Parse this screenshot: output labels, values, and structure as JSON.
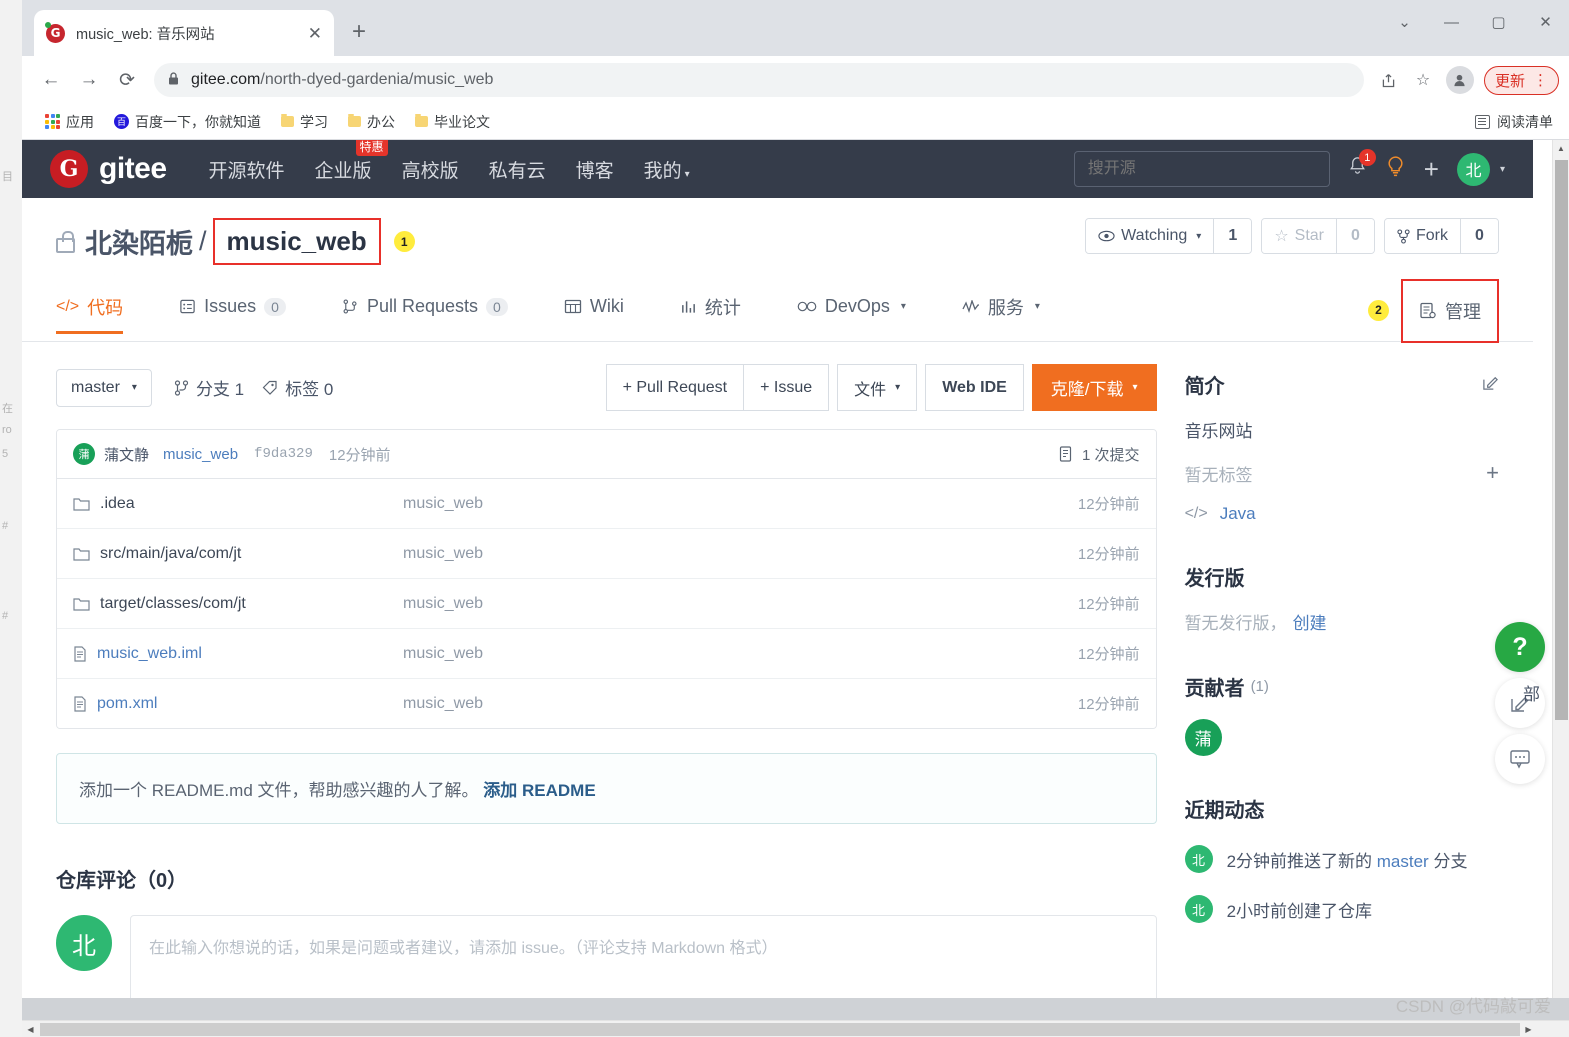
{
  "browser": {
    "tab": {
      "title": "music_web: 音乐网站",
      "favicon": "gitee-favicon",
      "close": "✕"
    },
    "new_tab": "+",
    "window_controls": {
      "minimize_more": "⌄",
      "minimize": "—",
      "maximize": "▢",
      "close": "✕"
    },
    "nav": {
      "back": "←",
      "forward": "→",
      "reload": "⟳"
    },
    "url": {
      "lock": "🔒",
      "domain": "gitee.com",
      "path": "/north-dyed-gardenia/music_web",
      "full": "gitee.com/north-dyed-gardenia/music_web"
    },
    "omnibox_actions": {
      "share": "share-icon",
      "bookmark": "☆",
      "profile": "profile-icon"
    },
    "update_button": {
      "label": "更新",
      "menu": "⋮"
    },
    "bookmarks": [
      {
        "label": "应用",
        "icon": "apps-grid-icon"
      },
      {
        "label": "百度一下，你就知道",
        "icon": "baidu-icon"
      },
      {
        "label": "学习",
        "icon": "folder-icon"
      },
      {
        "label": "办公",
        "icon": "folder-icon"
      },
      {
        "label": "毕业论文",
        "icon": "folder-icon"
      }
    ],
    "reading_list": {
      "label": "阅读清单",
      "icon": "reading-list-icon"
    }
  },
  "gitee_nav": {
    "logo_mark": "G",
    "logo_text": "gitee",
    "links": [
      {
        "label": "开源软件",
        "badge": ""
      },
      {
        "label": "企业版",
        "badge": "特惠"
      },
      {
        "label": "高校版",
        "badge": ""
      },
      {
        "label": "私有云",
        "badge": ""
      },
      {
        "label": "博客",
        "badge": ""
      },
      {
        "label": "我的",
        "badge": "",
        "caret": "▾"
      }
    ],
    "search_placeholder": "搜开源",
    "notifications_count": "1",
    "bulb_icon": "lightbulb-icon",
    "plus_icon": "+",
    "avatar": "北",
    "avatar_caret": "▾"
  },
  "repo": {
    "owner": "北染陌栀",
    "separator": "/",
    "name": "music_web",
    "annotation_1": "1",
    "watching": {
      "label": "Watching",
      "count": "1",
      "caret": "▾",
      "icon": "eye-icon"
    },
    "star": {
      "label": "Star",
      "count": "0",
      "icon": "star-icon"
    },
    "fork": {
      "label": "Fork",
      "count": "0",
      "icon": "fork-icon"
    }
  },
  "tabs": [
    {
      "label": "代码",
      "icon": "code-icon",
      "count": "",
      "active": true
    },
    {
      "label": "Issues",
      "icon": "issues-icon",
      "count": "0",
      "active": false
    },
    {
      "label": "Pull Requests",
      "icon": "pull-request-icon",
      "count": "0",
      "active": false
    },
    {
      "label": "Wiki",
      "icon": "wiki-icon",
      "count": "",
      "active": false
    },
    {
      "label": "统计",
      "icon": "chart-icon",
      "count": "",
      "active": false
    },
    {
      "label": "DevOps",
      "icon": "devops-icon",
      "count": "",
      "caret": "▾",
      "active": false
    },
    {
      "label": "服务",
      "icon": "service-icon",
      "count": "",
      "caret": "▾",
      "active": false
    }
  ],
  "tabs_annotation_2": "2",
  "manage_tab": {
    "label": "管理",
    "icon": "manage-icon"
  },
  "toolbar": {
    "branch": "master",
    "branch_caret": "▾",
    "branches_label": "分支 1",
    "tags_label": "标签 0",
    "pull_request_btn": "+ Pull Request",
    "issue_btn": "+ Issue",
    "files_btn": "文件",
    "files_caret": "▾",
    "web_ide_btn": "Web IDE",
    "clone_btn": "克隆/下载",
    "clone_caret": "▾"
  },
  "commit": {
    "avatar": "蒲",
    "author": "蒲文静",
    "message": "music_web",
    "sha": "f9da329",
    "time": "12分钟前",
    "count_label": "1 次提交",
    "count_icon": "commits-icon"
  },
  "files": [
    {
      "name": ".idea",
      "type": "dir",
      "message": "music_web",
      "time": "12分钟前"
    },
    {
      "name": "src/main/java/com/jt",
      "type": "dir",
      "message": "music_web",
      "time": "12分钟前"
    },
    {
      "name": "target/classes/com/jt",
      "type": "dir",
      "message": "music_web",
      "time": "12分钟前"
    },
    {
      "name": "music_web.iml",
      "type": "file",
      "message": "music_web",
      "time": "12分钟前"
    },
    {
      "name": "pom.xml",
      "type": "file",
      "message": "music_web",
      "time": "12分钟前"
    }
  ],
  "readme_notice": {
    "text": "添加一个 README.md 文件，帮助感兴趣的人了解。",
    "link": "添加 README"
  },
  "comments": {
    "title": "仓库评论（0）",
    "avatar": "北",
    "placeholder": "在此输入你想说的话，如果是问题或者建议，请添加 issue。（评论支持 Markdown 格式）"
  },
  "sidebar": {
    "intro_title": "简介",
    "intro_edit_icon": "edit-icon",
    "description": "音乐网站",
    "no_tags": "暂无标签",
    "add_tag_icon": "+",
    "language": "Java",
    "language_icon": "code-icon",
    "releases_title": "发行版",
    "no_releases": "暂无发行版，",
    "create_release": "创建",
    "contributors_title": "贡献者",
    "contributors_count": "(1)",
    "contributor_avatar": "蒲",
    "activity_title": "近期动态",
    "activities": [
      {
        "avatar": "北",
        "prefix": "2分钟前推送了新的",
        "branch": "master",
        "suffix": "分支"
      },
      {
        "avatar": "北",
        "prefix": "2小时前创建了仓库",
        "branch": "",
        "suffix": ""
      }
    ]
  },
  "floaters": {
    "help": "?",
    "feedback_icon": "feedback-edit-icon",
    "chat_icon": "chat-icon",
    "label": "部"
  },
  "watermark": "CSDN @代码敲可爱",
  "colors": {
    "gitee_red": "#c71d23",
    "accent_orange": "#f06e20",
    "nav_dark": "#353c4a",
    "annotation_red": "#e8302a",
    "annotation_yellow": "#ffec3d",
    "green": "#2eb872"
  }
}
